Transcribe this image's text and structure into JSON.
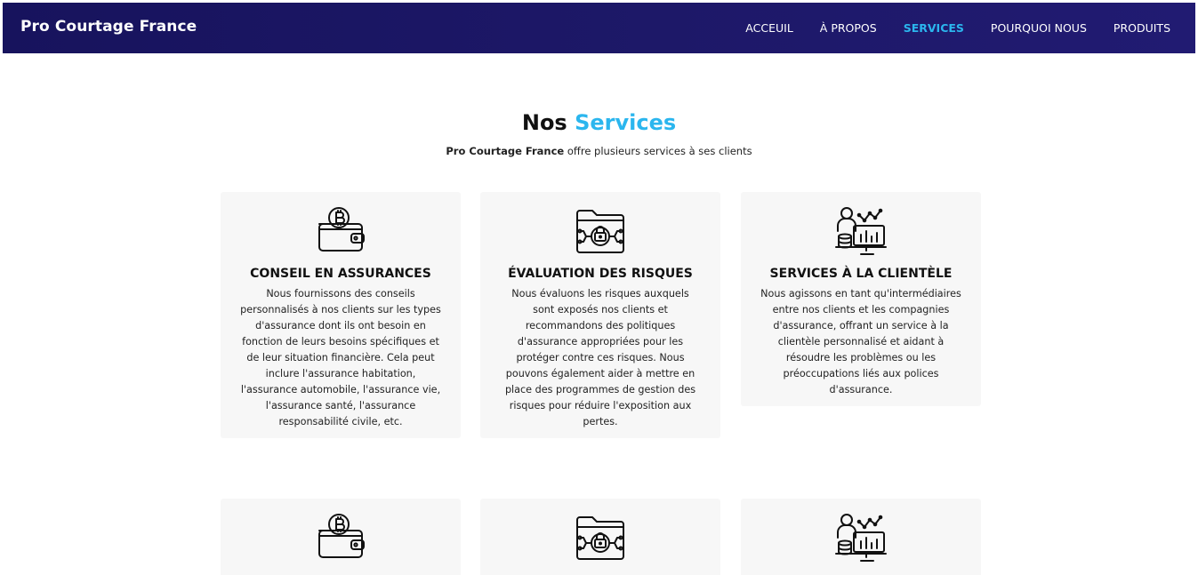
{
  "nav": {
    "brand": "Pro Courtage France",
    "links": [
      {
        "label": "ACCEUIL",
        "active": false
      },
      {
        "label": "À PROPOS",
        "active": false
      },
      {
        "label": "SERVICES",
        "active": true
      },
      {
        "label": "POURQUOI NOUS",
        "active": false
      },
      {
        "label": "PRODUITS",
        "active": false
      }
    ],
    "accent_color": "#2bb6ee",
    "bar_color": "#1a1663"
  },
  "section": {
    "title_plain": "Nos",
    "title_accent": "Services",
    "subtitle_brand": "Pro Courtage France",
    "subtitle_rest": "offre plusieurs services à ses clients"
  },
  "cards": [
    {
      "icon": "wallet-bitcoin-icon",
      "title": "CONSEIL EN ASSURANCES",
      "text": "Nous fournissons des conseils personnalisés à nos clients sur les types d'assurance dont ils ont besoin en fonction de leurs besoins spécifiques et de leur situation financière. Cela peut inclure l'assurance habitation, l'assurance automobile, l'assurance vie, l'assurance santé, l'assurance responsabilité civile, etc."
    },
    {
      "icon": "secure-folder-icon",
      "title": "ÉVALUATION DES RISQUES",
      "text": "Nous évaluons les risques auxquels sont exposés nos clients et recommandons des politiques d'assurance appropriées pour les protéger contre ces risques. Nous pouvons également aider à mettre en place des programmes de gestion des risques pour réduire l'exposition aux pertes."
    },
    {
      "icon": "customer-analytics-icon",
      "title": "SERVICES À LA CLIENTÈLE",
      "text": "Nous agissons en tant qu'intermédiaires entre nos clients et les compagnies d'assurance, offrant un service à la clientèle personnalisé et aidant à résoudre les problèmes ou les préoccupations liés aux polices d'assurance."
    },
    {
      "icon": "wallet-bitcoin-icon",
      "title": "",
      "text": ""
    },
    {
      "icon": "secure-folder-icon",
      "title": "",
      "text": ""
    },
    {
      "icon": "customer-analytics-icon",
      "title": "",
      "text": ""
    }
  ]
}
